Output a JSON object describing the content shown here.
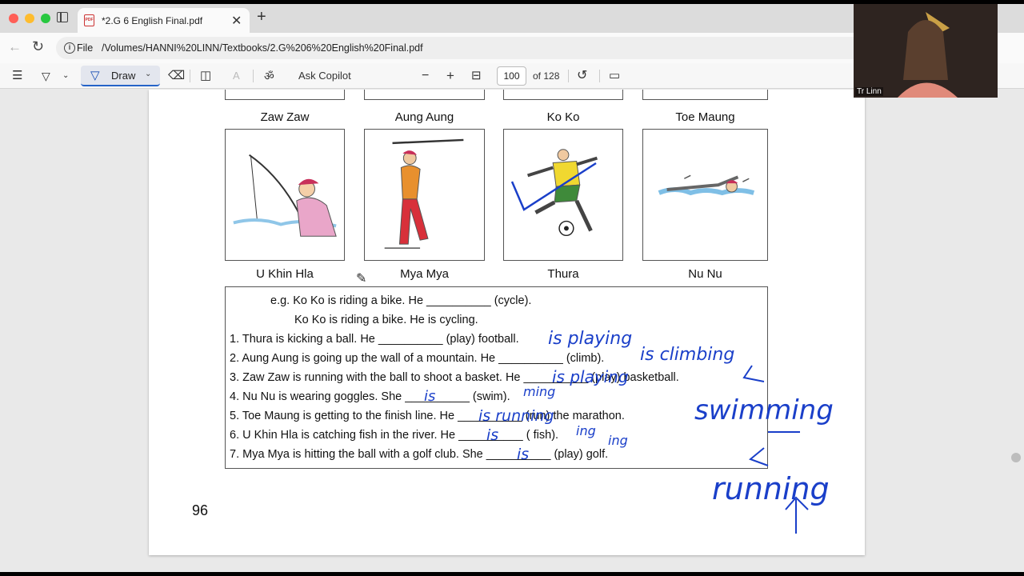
{
  "browser": {
    "tab_title": "*2.G 6 English Final.pdf",
    "close_glyph": "✕",
    "newtab_glyph": "+",
    "url_scheme_label": "File",
    "url": "/Volumes/HANNI%20LINN/Textbooks/2.G%206%20English%20Final.pdf"
  },
  "toolbar": {
    "draw_label": "Draw",
    "ask_copilot": "Ask Copilot",
    "page_current": "100",
    "page_total": "of 128",
    "zoom_out": "−",
    "zoom_in": "+"
  },
  "worksheet": {
    "top_names": [
      "Zaw Zaw",
      "Aung Aung",
      "Ko Ko",
      "Toe Maung"
    ],
    "bottom_names": [
      "U Khin Hla",
      "Mya Mya",
      "Thura",
      "Nu Nu"
    ],
    "example_line1": "e.g. Ko Ko is riding a bike. He __________ (cycle).",
    "example_line2": "Ko Ko is riding a bike. He is cycling.",
    "items": [
      "1. Thura is kicking a ball. He __________ (play) football.",
      "2. Aung Aung is going up the wall of a mountain. He __________ (climb).",
      "3. Zaw Zaw is running with the ball to shoot a basket. He __________ (play) basketball.",
      "4. Nu Nu is wearing goggles. She __________ (swim).",
      "5. Toe Maung is getting to the finish line. He __________ (run) the marathon.",
      "6. U Khin Hla is catching fish in the river. He __________ ( fish).",
      "7. Mya Mya is hitting the ball with a golf club. She __________ (play) golf."
    ],
    "page_number": "96"
  },
  "annotations": {
    "ink_color": "#1a3fc9",
    "a1": "is playing",
    "a2": "is climbing",
    "a3": "is playing",
    "a4": "is",
    "a4b": "ming",
    "a5": "is running",
    "a6": "is",
    "a6b": "ing",
    "a7": "is",
    "a7b": "ing",
    "big1": "swimming",
    "big2": "running"
  },
  "webcam": {
    "name": "Tr Linn"
  }
}
